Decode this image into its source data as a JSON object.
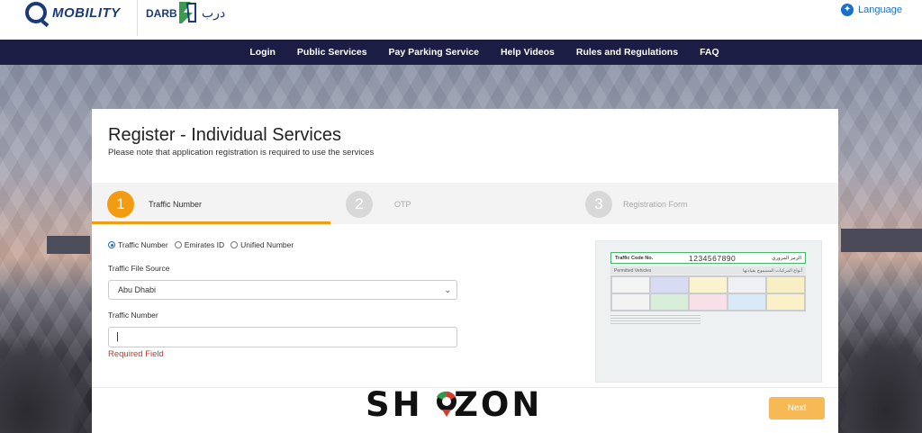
{
  "header": {
    "logo_mobility": "MOBILITY",
    "logo_darb": "DARB",
    "logo_darb_arabic": "درب",
    "language_label": "Language"
  },
  "nav": {
    "items": [
      "Login",
      "Public Services",
      "Pay Parking Service",
      "Help Videos",
      "Rules and Regulations",
      "FAQ"
    ]
  },
  "page": {
    "title": "Register - Individual Services",
    "subtitle": "Please note that application registration is required to use the services"
  },
  "steps": [
    {
      "number": "1",
      "label": "Traffic Number",
      "active": true
    },
    {
      "number": "2",
      "label": "OTP",
      "active": false
    },
    {
      "number": "3",
      "label": "Registration Form",
      "active": false
    }
  ],
  "form": {
    "id_types": [
      {
        "label": "Traffic Number",
        "selected": true
      },
      {
        "label": "Emirates ID",
        "selected": false
      },
      {
        "label": "Unified Number",
        "selected": false
      }
    ],
    "source_label": "Traffic File Source",
    "source_value": "Abu Dhabi",
    "traffic_number_label": "Traffic Number",
    "traffic_number_value": "",
    "error": "Required Field",
    "next_label": "Next"
  },
  "license": {
    "code_label": "Traffic Code No.",
    "code_number": "1234567890",
    "code_label_ar": "الرمز المروري",
    "permitted_label": "Permitted Vehicles",
    "permitted_label_ar": "أنواع المركبات المسموح بقيادتها"
  },
  "watermark": {
    "text": "SHOZON"
  },
  "colors": {
    "nav_bg": "#1b1d45",
    "accent": "#f39c12",
    "error": "#c0392b",
    "link": "#1a6fc9"
  }
}
